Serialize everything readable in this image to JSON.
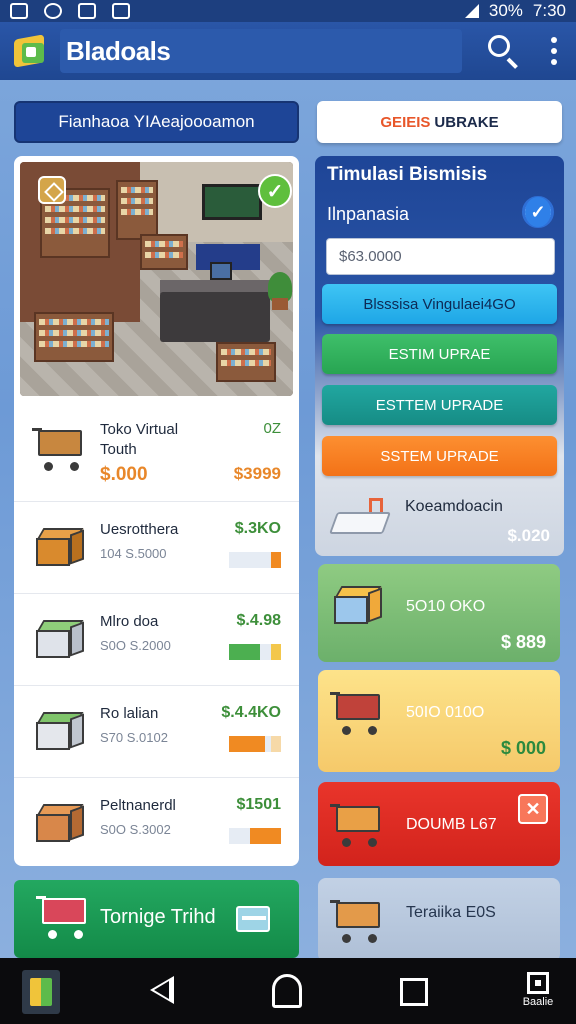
{
  "status_bar": {
    "battery": "30%",
    "time": "7:30"
  },
  "app_bar": {
    "title": "Bladoals"
  },
  "top_buttons": {
    "left_label": "Fianhaoa YIAeajoooamon",
    "right_accent": "GEIEIS",
    "right_label": "UBRAKE"
  },
  "left_panel": {
    "items": [
      {
        "name": "Toko Virtual\nTouth",
        "pct": "0Z",
        "big": "$.000",
        "price2": "$3999"
      },
      {
        "name": "Uesrotthera",
        "sub": "104 S.5000",
        "price": "$.3KO"
      },
      {
        "name": "Mlro doa",
        "sub": "S0O S.2000",
        "price": "$.4.98"
      },
      {
        "name": "Ro lalian",
        "sub": "S70 S.0102",
        "price": "$.4.4KO"
      },
      {
        "name": "Peltnanerdl",
        "sub": "S0O S.3002",
        "price": "$1501"
      }
    ]
  },
  "right_panel": {
    "title": "Timulasi Bismisis",
    "subtitle": "Ilnpanasia",
    "input_value": "$63.0000",
    "buttons": [
      "Blsssisa Vingulaei4GO",
      "ESTIM UPRAE",
      "ESTTEM UPRADE",
      "SSTEM UPRADE"
    ],
    "footer_label": "Koeamdoacin",
    "footer_price": "$.020"
  },
  "cards": [
    {
      "label": "5O10 OKO",
      "value": "$ 889"
    },
    {
      "label": "50IO 010O",
      "value": "$ 000"
    },
    {
      "label": "DOUMB L67",
      "close": "✕"
    },
    {
      "label": "Teraiika E0S"
    }
  ],
  "green_button": {
    "label": "Tornige Trihd"
  },
  "nav": {
    "extra_label": "Baalie"
  },
  "colors": {
    "primary_blue": "#1e4597",
    "accent_orange": "#e8872a",
    "success_green": "#3d8f3a",
    "danger_red": "#d2231c"
  }
}
